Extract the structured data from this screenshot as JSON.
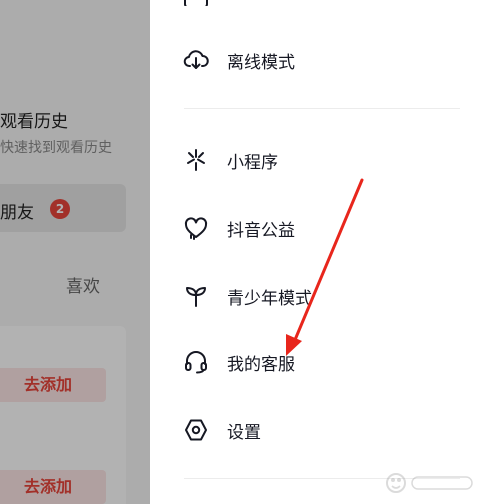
{
  "background": {
    "history_title": "观看历史",
    "history_subtitle": "快速找到观看历史",
    "friends_label": "朋友",
    "friends_badge": "2",
    "tab_like": "喜欢",
    "add_button_1": "去添加",
    "add_button_2": "去添加"
  },
  "menu": {
    "items": [
      {
        "label": "离线模式",
        "icon": "cloud-download-icon"
      },
      {
        "label": "小程序",
        "icon": "mini-program-icon"
      },
      {
        "label": "抖音公益",
        "icon": "charity-heart-icon"
      },
      {
        "label": "青少年模式",
        "icon": "sprout-icon"
      },
      {
        "label": "我的客服",
        "icon": "headset-icon"
      },
      {
        "label": "设置",
        "icon": "settings-hexagon-icon"
      }
    ]
  },
  "colors": {
    "accent": "#e8453c",
    "menu_text": "#161823",
    "annotation_arrow": "#e8261c"
  }
}
